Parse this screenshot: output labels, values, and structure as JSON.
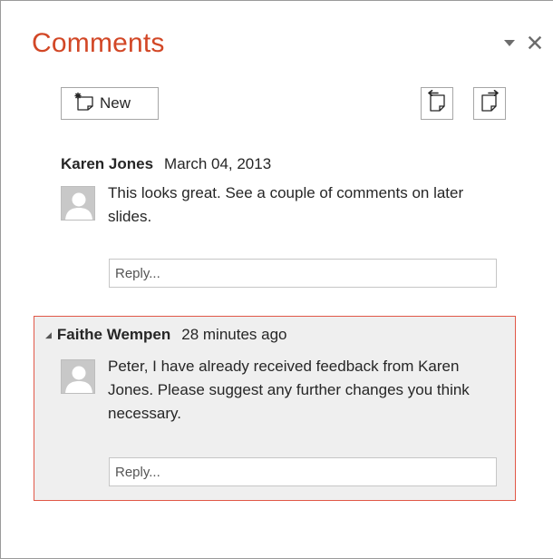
{
  "pane": {
    "title": "Comments",
    "menu_icon": "chevron-down-icon",
    "close_icon": "close-icon"
  },
  "toolbar": {
    "new_label": "New",
    "new_icon": "new-comment-icon",
    "previous_icon": "previous-comment-icon",
    "next_icon": "next-comment-icon"
  },
  "threads": [
    {
      "author": "Karen Jones",
      "timestamp": "March 04, 2013",
      "text": "This looks great. See a couple of comments on later slides.",
      "reply_placeholder": "Reply...",
      "selected": false
    },
    {
      "author": "Faithe Wempen",
      "timestamp": "28 minutes ago",
      "text": "Peter, I have already received feedback from Karen Jones. Please suggest any further changes you think necessary.",
      "reply_placeholder": "Reply...",
      "selected": true
    }
  ],
  "colors": {
    "title": "#d24726",
    "selected_border": "#e15848",
    "selected_background": "#efefef"
  }
}
